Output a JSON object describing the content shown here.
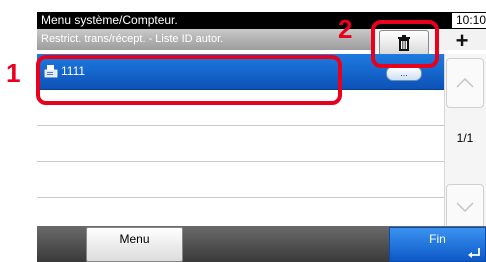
{
  "header": {
    "title": "Menu système/Compteur.",
    "clock": "10:10",
    "subtitle": "Restrict. trans/récept.  - Liste ID autor."
  },
  "toolbar": {
    "delete_icon": "trash-icon",
    "add_label": "+"
  },
  "list": {
    "rows": [
      {
        "label": "1111",
        "selected": true,
        "icon": "fax-machine-icon",
        "detail_label": "..."
      },
      {
        "label": ""
      },
      {
        "label": ""
      },
      {
        "label": ""
      },
      {
        "label": ""
      }
    ]
  },
  "pager": {
    "page": "1/1"
  },
  "footer": {
    "menu_label": "Menu",
    "fin_label": "Fin"
  },
  "callouts": {
    "one": "1",
    "two": "2"
  },
  "colors": {
    "selected_row": "#0d52b8",
    "callout": "#e8001c",
    "fin_button": "#0d58c7"
  }
}
